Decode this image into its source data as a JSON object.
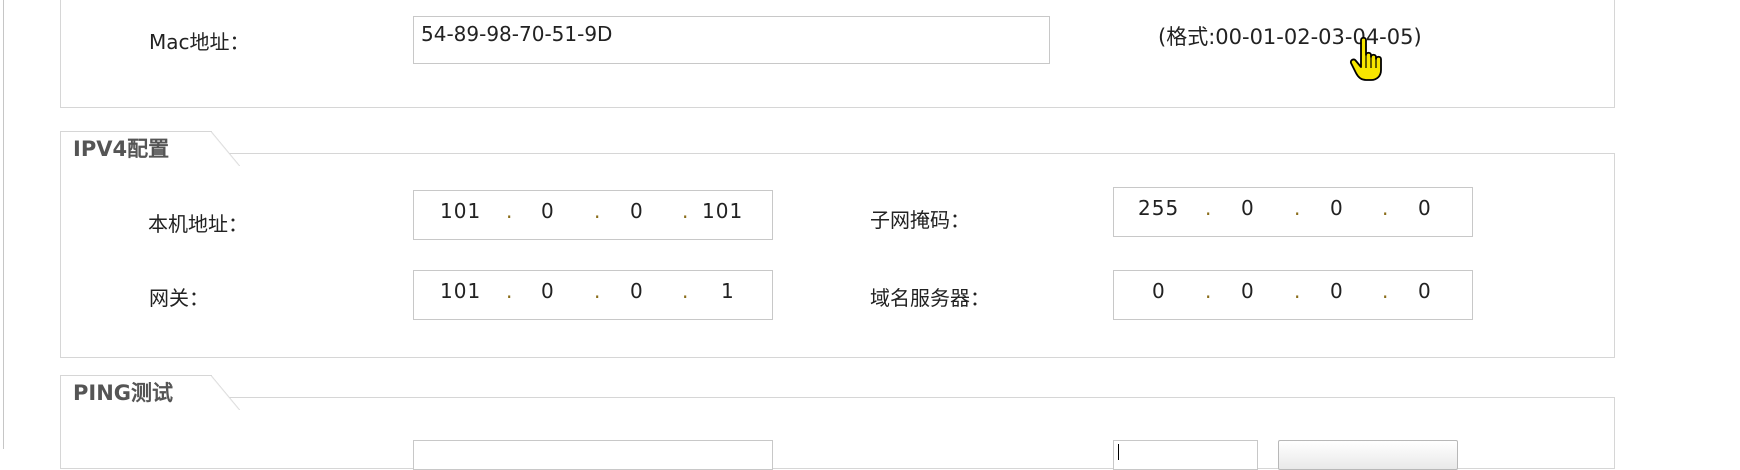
{
  "mac": {
    "label": "Mac地址：",
    "value": "54-89-98-70-51-9D",
    "format_hint": "(格式:00-01-02-03-04-05)"
  },
  "ipv4": {
    "title": "IPV4配置",
    "local_address": {
      "label": "本机地址：",
      "octets": [
        "101",
        "0",
        "0",
        "101"
      ]
    },
    "subnet_mask": {
      "label": "子网掩码：",
      "octets": [
        "255",
        "0",
        "0",
        "0"
      ]
    },
    "gateway": {
      "label": "网关：",
      "octets": [
        "101",
        "0",
        "0",
        "1"
      ]
    },
    "dns": {
      "label": "域名服务器：",
      "octets": [
        "0",
        "0",
        "0",
        "0"
      ]
    }
  },
  "ping": {
    "title": "PING测试"
  },
  "colors": {
    "border": "#d6d6d6",
    "dot": "#8a6d1a",
    "cursor_fill": "#f7e600"
  },
  "icons": {
    "cursor": "hand-pointer-icon"
  }
}
